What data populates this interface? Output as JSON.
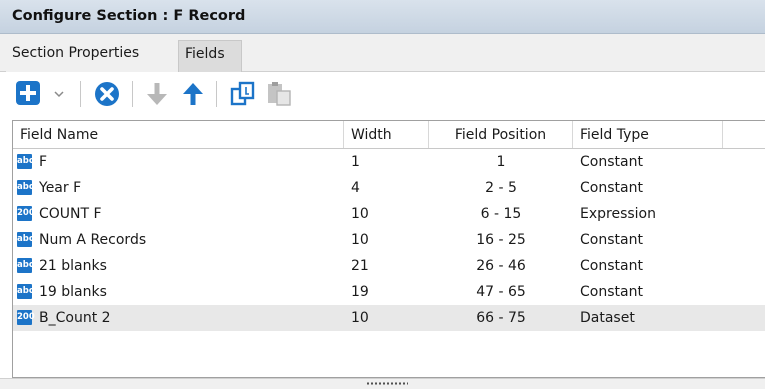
{
  "window": {
    "title": "Configure Section : F Record"
  },
  "tabs": [
    {
      "label": "Section Properties",
      "active": false
    },
    {
      "label": "Fields",
      "active": true
    }
  ],
  "toolbar": {
    "buttons": [
      {
        "icon": "add-icon",
        "color": "#1c74c8"
      },
      {
        "icon": "dropdown-arrow-icon"
      },
      {
        "icon": "delete-icon",
        "color": "#1c74c8"
      },
      {
        "icon": "move-down-icon",
        "enabled": false
      },
      {
        "icon": "move-up-icon",
        "enabled": true
      },
      {
        "icon": "copy-icon",
        "enabled": true
      },
      {
        "icon": "paste-icon",
        "enabled": false
      }
    ]
  },
  "grid": {
    "columns": [
      "Field Name",
      "Width",
      "Field Position",
      "Field Type"
    ],
    "rows": [
      {
        "badge": "abc",
        "name": "F",
        "width": "1",
        "position": "1",
        "type": "Constant",
        "selected": false
      },
      {
        "badge": "abc",
        "name": "Year F",
        "width": "4",
        "position": "2 - 5",
        "type": "Constant",
        "selected": false
      },
      {
        "badge": "200",
        "name": "COUNT F",
        "width": "10",
        "position": "6 - 15",
        "type": "Expression",
        "selected": false
      },
      {
        "badge": "abc",
        "name": "Num A Records",
        "width": "10",
        "position": "16 - 25",
        "type": "Constant",
        "selected": false
      },
      {
        "badge": "abc",
        "name": "21 blanks",
        "width": "21",
        "position": "26 - 46",
        "type": "Constant",
        "selected": false
      },
      {
        "badge": "abc",
        "name": "19 blanks",
        "width": "19",
        "position": "47 - 65",
        "type": "Constant",
        "selected": false
      },
      {
        "badge": "200",
        "name": "B_Count 2",
        "width": "10",
        "position": "66 - 75",
        "type": "Dataset",
        "selected": true
      }
    ]
  },
  "colors": {
    "accent": "#1c74c8",
    "selected_row": "#e8e8e8",
    "title_bar": "#c5d2e0"
  }
}
